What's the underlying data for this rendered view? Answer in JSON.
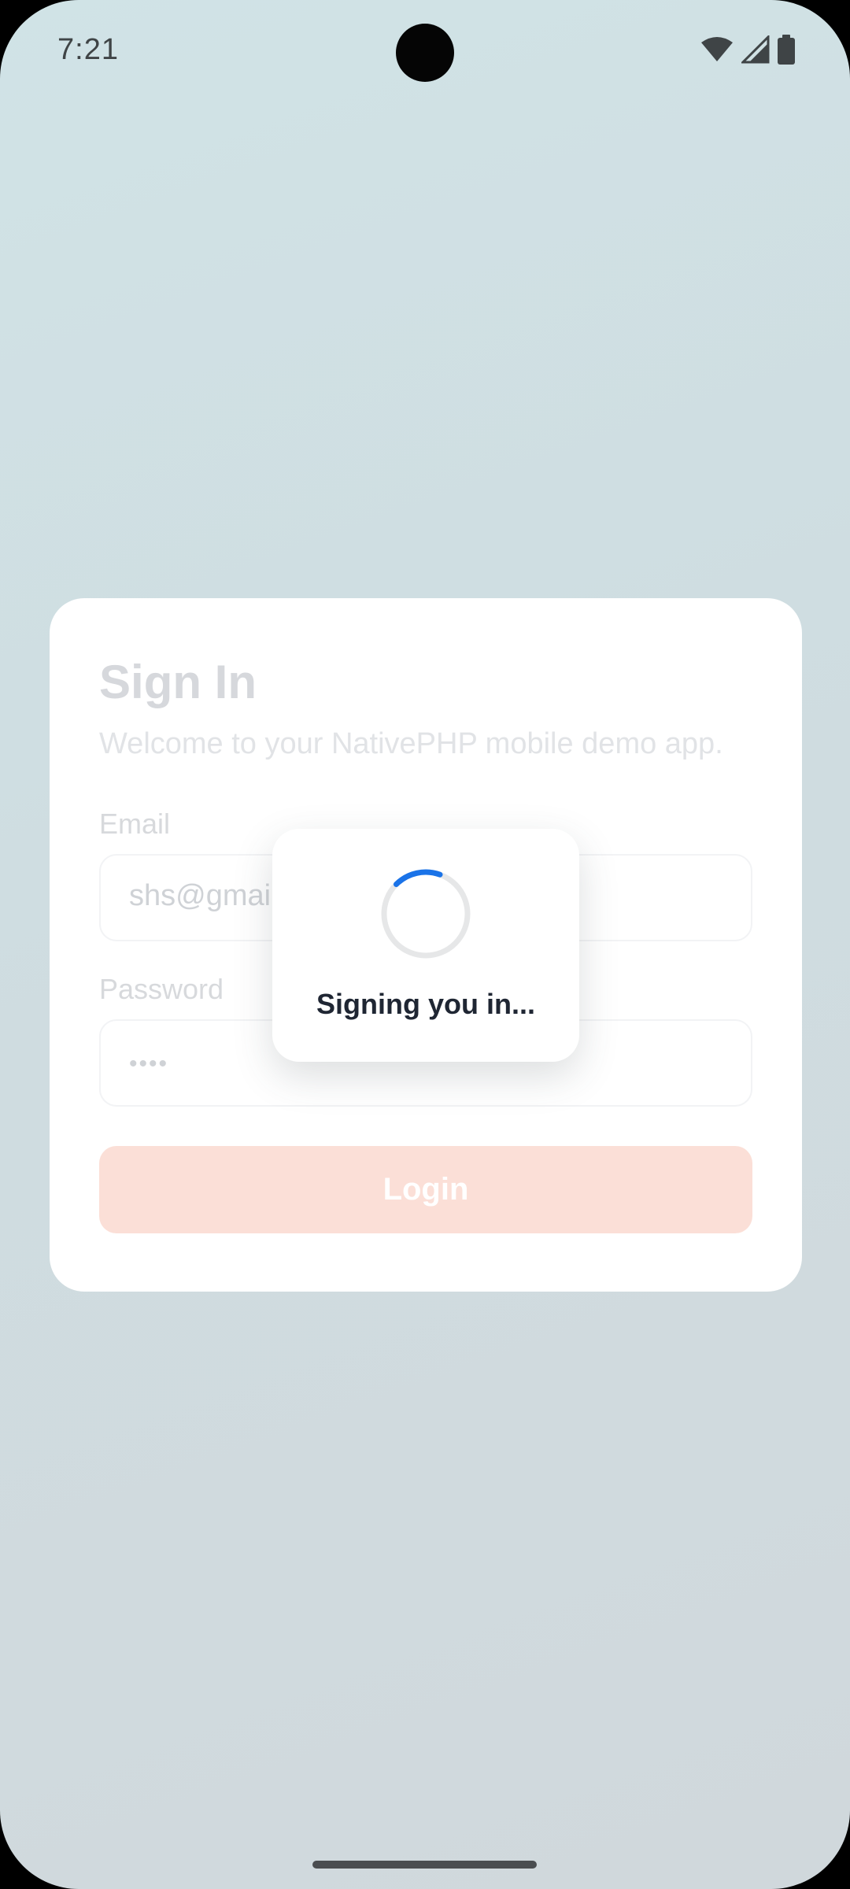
{
  "status_bar": {
    "time": "7:21",
    "icons": [
      "wifi-icon",
      "cell-signal-icon",
      "battery-icon"
    ]
  },
  "sign_in": {
    "title": "Sign In",
    "subtitle": "Welcome to your NativePHP mobile demo app.",
    "email_label": "Email",
    "email_value": "shs@gmai",
    "password_label": "Password",
    "password_value": "••••",
    "login_label": "Login"
  },
  "loading": {
    "message": "Signing you in..."
  },
  "colors": {
    "accent_spinner": "#1a73e8",
    "login_button": "#fbdfd7",
    "text_dark": "#1f2633"
  }
}
